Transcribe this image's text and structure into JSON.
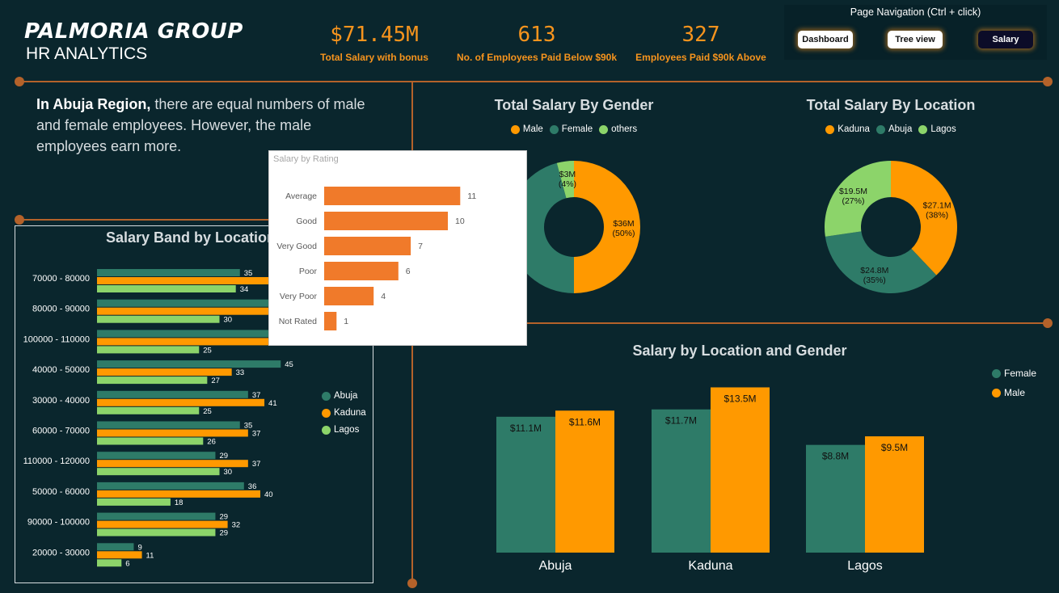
{
  "brand": {
    "title": "PALMORIA GROUP",
    "subtitle": "HR ANALYTICS"
  },
  "kpis": [
    {
      "value": "$71.45M",
      "label": "Total Salary with bonus"
    },
    {
      "value": "613",
      "label": "No. of Employees Paid Below $90k"
    },
    {
      "value": "327",
      "label": "Employees Paid $90k  Above"
    }
  ],
  "nav": {
    "title": "Page Navigation  (Ctrl + click)",
    "buttons": [
      "Dashboard",
      "Tree view",
      "Salary"
    ],
    "active": "Salary"
  },
  "insight": {
    "lead": "In Abuja Region,",
    "text": " there are equal numbers of male and female  employees. However, the male employees earn more."
  },
  "colors": {
    "orange": "#ff9900",
    "teal": "#2e7b68",
    "green": "#8cd46a",
    "accent": "#f7941d",
    "rating_bar": "#f07a2a",
    "line": "#b4622a",
    "background": "#0a262d"
  },
  "salary_band": {
    "title": "Salary Band by Location",
    "legend": [
      "Abuja",
      "Kaduna",
      "Lagos"
    ]
  },
  "salary_rating": {
    "title": "Salary by Rating"
  },
  "gender_donut": {
    "title": "Total Salary By Gender",
    "legend": [
      "Male",
      "Female",
      "others"
    ]
  },
  "location_donut": {
    "title": "Total Salary By Location",
    "legend": [
      "Kaduna",
      "Abuja",
      "Lagos"
    ]
  },
  "loc_gender": {
    "title": "Salary by Location and Gender",
    "legend": [
      "Female",
      "Male"
    ]
  },
  "chart_data": [
    {
      "id": "salary_band",
      "type": "bar",
      "orientation": "horizontal",
      "title": "Salary Band by Location",
      "categories": [
        "70000 - 80000",
        "80000 - 90000",
        "100000 - 110000",
        "40000 - 50000",
        "30000 - 40000",
        "60000 - 70000",
        "110000 - 120000",
        "50000 - 60000",
        "90000 - 100000",
        "20000 - 30000"
      ],
      "series": [
        {
          "name": "Abuja",
          "values": [
            35,
            44,
            44,
            45,
            37,
            35,
            29,
            36,
            29,
            9
          ],
          "labels": [
            "35",
            null,
            null,
            "45",
            "37",
            "35",
            "29",
            "36",
            "29",
            "9"
          ]
        },
        {
          "name": "Kaduna",
          "values": [
            44,
            43,
            45,
            33,
            41,
            37,
            37,
            40,
            32,
            11
          ],
          "labels": [
            null,
            null,
            null,
            "33",
            "41",
            "37",
            "37",
            "40",
            "32",
            "11"
          ]
        },
        {
          "name": "Lagos",
          "values": [
            34,
            30,
            25,
            27,
            25,
            26,
            30,
            18,
            29,
            6
          ],
          "labels": [
            "34",
            "30",
            "25",
            "27",
            "25",
            "26",
            "30",
            "18",
            "29",
            "6"
          ]
        }
      ],
      "legend": "right"
    },
    {
      "id": "salary_rating",
      "type": "bar",
      "orientation": "horizontal",
      "title": "Salary by Rating",
      "categories": [
        "Average",
        "Good",
        "Very Good",
        "Poor",
        "Very Poor",
        "Not Rated"
      ],
      "values": [
        11,
        10,
        7,
        6,
        4,
        1
      ]
    },
    {
      "id": "gender_donut",
      "type": "pie",
      "title": "Total Salary By Gender",
      "slices": [
        {
          "name": "Male",
          "value": 36,
          "label": "$36M",
          "pct": "(50%)"
        },
        {
          "name": "Female",
          "value": 33,
          "label": "",
          "pct": ""
        },
        {
          "name": "others",
          "value": 3,
          "label": "$3M",
          "pct": "(4%)"
        }
      ],
      "legend": "top"
    },
    {
      "id": "location_donut",
      "type": "pie",
      "title": "Total Salary By Location",
      "slices": [
        {
          "name": "Kaduna",
          "value": 27.1,
          "label": "$27.1M",
          "pct": "(38%)"
        },
        {
          "name": "Abuja",
          "value": 24.8,
          "label": "$24.8M",
          "pct": "(35%)"
        },
        {
          "name": "Lagos",
          "value": 19.5,
          "label": "$19.5M",
          "pct": "(27%)"
        }
      ],
      "legend": "top"
    },
    {
      "id": "loc_gender",
      "type": "bar",
      "title": "Salary by Location and Gender",
      "categories": [
        "Abuja",
        "Kaduna",
        "Lagos"
      ],
      "series": [
        {
          "name": "Female",
          "values": [
            11.1,
            11.7,
            8.8
          ],
          "labels": [
            "$11.1M",
            "$11.7M",
            "$8.8M"
          ]
        },
        {
          "name": "Male",
          "values": [
            11.6,
            13.5,
            9.5
          ],
          "labels": [
            "$11.6M",
            "$13.5M",
            "$9.5M"
          ]
        }
      ],
      "legend": "right"
    }
  ]
}
